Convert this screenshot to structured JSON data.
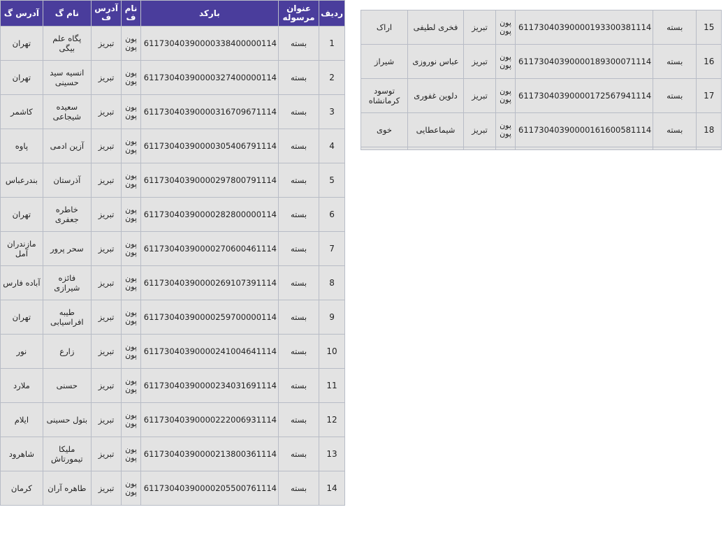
{
  "headers": {
    "row_no": "ردیف",
    "shipment_title": "عنوان مرسوله",
    "barcode": "بارکد",
    "sender_name": "نام ف",
    "sender_address": "آدرس ف",
    "receiver_name": "نام گ",
    "receiver_address": "آدرس گ"
  },
  "main_rows": [
    {
      "no": "1",
      "type": "بسته",
      "barcode": "61173040390000338400000114",
      "sender": "پون پون",
      "from": "تبریز",
      "receiver": "پگاه علم بیگی",
      "to": "تهران"
    },
    {
      "no": "2",
      "type": "بسته",
      "barcode": "61173040390000327400000114",
      "sender": "پون پون",
      "from": "تبریز",
      "receiver": "انسیه سید حسینی",
      "to": "تهران"
    },
    {
      "no": "3",
      "type": "بسته",
      "barcode": "61173040390000316709671114",
      "sender": "پون پون",
      "from": "تبریز",
      "receiver": "سعیده شیجاعی",
      "to": "کاشمر"
    },
    {
      "no": "4",
      "type": "بسته",
      "barcode": "61173040390000305406791114",
      "sender": "پون پون",
      "from": "تبریز",
      "receiver": "آزین ادمی",
      "to": "پاوه"
    },
    {
      "no": "5",
      "type": "بسته",
      "barcode": "61173040390000297800791114",
      "sender": "پون پون",
      "from": "تبریز",
      "receiver": "آذرستان",
      "to": "بندرعباس"
    },
    {
      "no": "6",
      "type": "بسته",
      "barcode": "61173040390000282800000114",
      "sender": "پون پون",
      "from": "تبریز",
      "receiver": "خاطره جعفری",
      "to": "تهران"
    },
    {
      "no": "7",
      "type": "بسته",
      "barcode": "61173040390000270600461114",
      "sender": "پون پون",
      "from": "تبریز",
      "receiver": "سحر پرور",
      "to": "مازندران آمل"
    },
    {
      "no": "8",
      "type": "بسته",
      "barcode": "61173040390000269107391114",
      "sender": "پون پون",
      "from": "تبریز",
      "receiver": "فائزه شیرازی",
      "to": "آباده فارس"
    },
    {
      "no": "9",
      "type": "بسته",
      "barcode": "61173040390000259700000114",
      "sender": "پون پون",
      "from": "تبریز",
      "receiver": "طیبه افراسیابی",
      "to": "تهران"
    },
    {
      "no": "10",
      "type": "بسته",
      "barcode": "61173040390000241004641114",
      "sender": "پون پون",
      "from": "تبریز",
      "receiver": "زارع",
      "to": "نور"
    },
    {
      "no": "11",
      "type": "بسته",
      "barcode": "61173040390000234031691114",
      "sender": "پون پون",
      "from": "تبریز",
      "receiver": "حسنی",
      "to": "ملارد"
    },
    {
      "no": "12",
      "type": "بسته",
      "barcode": "61173040390000222006931114",
      "sender": "پون پون",
      "from": "تبریز",
      "receiver": "بتول حسینی",
      "to": "ایلام"
    },
    {
      "no": "13",
      "type": "بسته",
      "barcode": "61173040390000213800361114",
      "sender": "پون پون",
      "from": "تبریز",
      "receiver": "ملیکا تیمورتاش",
      "to": "شاهرود"
    },
    {
      "no": "14",
      "type": "بسته",
      "barcode": "61173040390000205500761114",
      "sender": "پون پون",
      "from": "تبریز",
      "receiver": "طاهره آران",
      "to": "کرمان"
    }
  ],
  "side_rows": [
    {
      "no": "15",
      "type": "بسته",
      "barcode": "61173040390000193300381114",
      "sender": "پون پون",
      "from": "تبریز",
      "receiver": "فخری لطیفی",
      "to": "اراک"
    },
    {
      "no": "16",
      "type": "بسته",
      "barcode": "61173040390000189300071114",
      "sender": "پون پون",
      "from": "تبریز",
      "receiver": "عباس نوروزی",
      "to": "شیراز"
    },
    {
      "no": "17",
      "type": "بسته",
      "barcode": "61173040390000172567941114",
      "sender": "پون پون",
      "from": "تبریز",
      "receiver": "دلوین غفوری",
      "to": "توسود کرمانشاه"
    },
    {
      "no": "18",
      "type": "بسته",
      "barcode": "61173040390000161600581114",
      "sender": "پون پون",
      "from": "تبریز",
      "receiver": "شیماعطایی",
      "to": "خوی"
    }
  ]
}
